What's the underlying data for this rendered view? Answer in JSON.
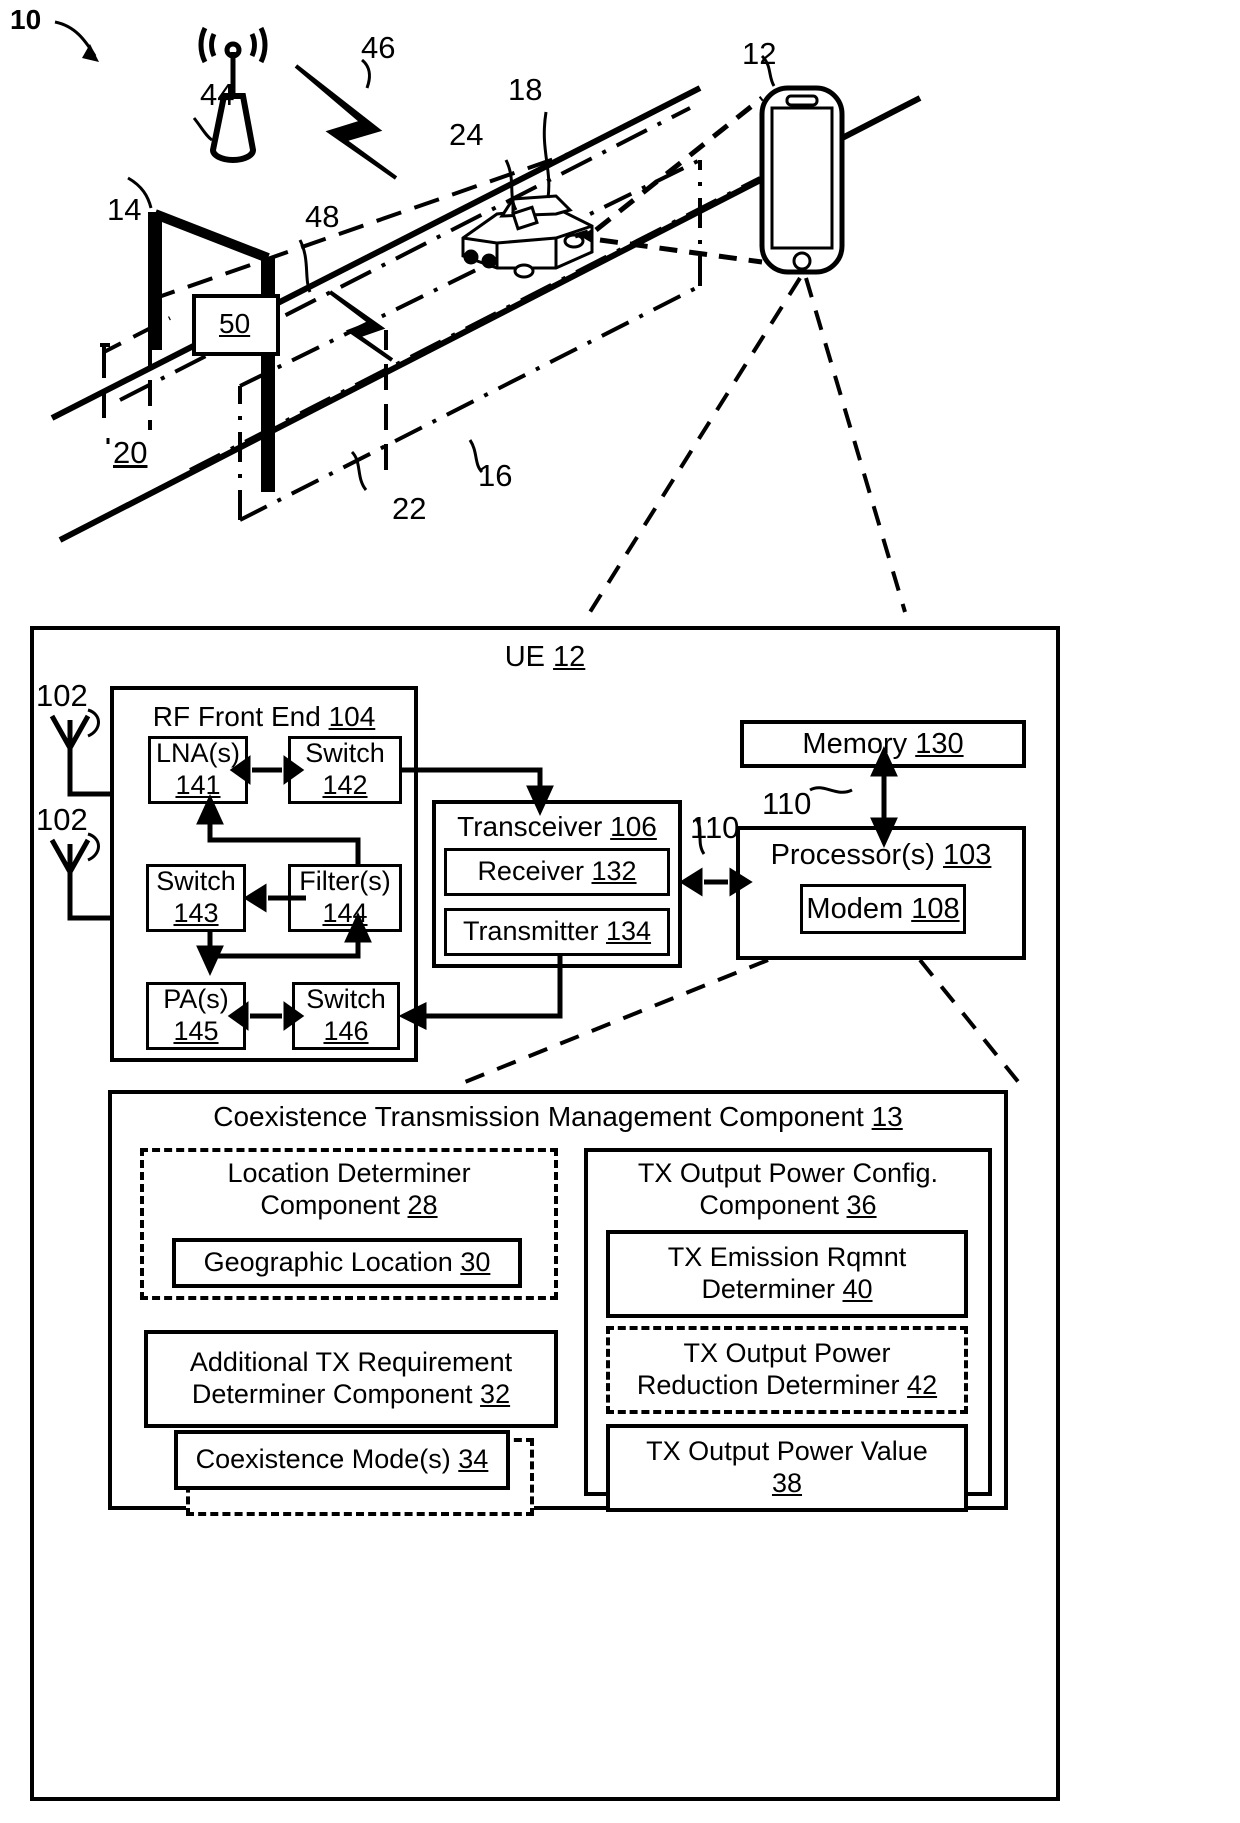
{
  "figure": {
    "number": "10",
    "callouts": {
      "c10": "10",
      "c12": "12",
      "c14": "14",
      "c16": "16",
      "c18": "18",
      "c20": "20",
      "c22": "22",
      "c24": "24",
      "c44": "44",
      "c46": "46",
      "c48": "48",
      "c50": "50",
      "c102a": "102",
      "c102b": "102",
      "c110a": "110",
      "c110b": "110"
    }
  },
  "scene": {
    "tower_label": "44",
    "tower_signal_label": "46",
    "roadside_unit_label": "50",
    "roadside_signal_label": "48",
    "gantry_label": "14",
    "road_label": "20",
    "lane_label": "22",
    "zone_label": "16",
    "vehicle_label": "18",
    "vehicle_module_label": "24",
    "phone_label": "12"
  },
  "ue": {
    "title": "UE",
    "title_num": "12",
    "antennas": [
      "102",
      "102"
    ],
    "rf_front_end": {
      "title": "RF Front End",
      "title_num": "104",
      "blocks": [
        {
          "line1": "LNA(s)",
          "num": "141"
        },
        {
          "line1": "Switch",
          "num": "142"
        },
        {
          "line1": "Switch",
          "num": "143"
        },
        {
          "line1": "Filter(s)",
          "num": "144"
        },
        {
          "line1": "PA(s)",
          "num": "145"
        },
        {
          "line1": "Switch",
          "num": "146"
        }
      ]
    },
    "transceiver": {
      "title": "Transceiver",
      "title_num": "106",
      "blocks": [
        {
          "label": "Receiver",
          "num": "132"
        },
        {
          "label": "Transmitter",
          "num": "134"
        }
      ]
    },
    "memory": {
      "label": "Memory",
      "num": "130"
    },
    "processor": {
      "label": "Processor(s)",
      "num": "103"
    },
    "modem": {
      "label": "Modem",
      "num": "108"
    },
    "bus_labels": [
      "110",
      "110"
    ]
  },
  "coexistence": {
    "title": "Coexistence Transmission Management Component",
    "title_num": "13",
    "left_column": [
      {
        "line1": "Location Determiner",
        "line2": "Component",
        "num": "28",
        "style": "dashed",
        "child": {
          "label": "Geographic Location",
          "num": "30"
        }
      },
      {
        "line1": "Additional TX Requirement",
        "line2": "Determiner Component",
        "num": "32",
        "style": "solid"
      },
      {
        "line1": "Coexistence Mode(s)",
        "num": "34",
        "style": "solid"
      }
    ],
    "right_column": [
      {
        "line1": "TX Output Power Config.",
        "line2": "Component",
        "num": "36",
        "style": "solid"
      },
      {
        "line1": "TX Emission Rqmnt",
        "line2": "Determiner",
        "num": "40",
        "style": "solid"
      },
      {
        "line1": "TX Output Power",
        "line2": "Reduction Determiner",
        "num": "42",
        "style": "dashed"
      },
      {
        "line1": "TX Output Power Value",
        "num": "38",
        "style": "solid"
      }
    ]
  }
}
